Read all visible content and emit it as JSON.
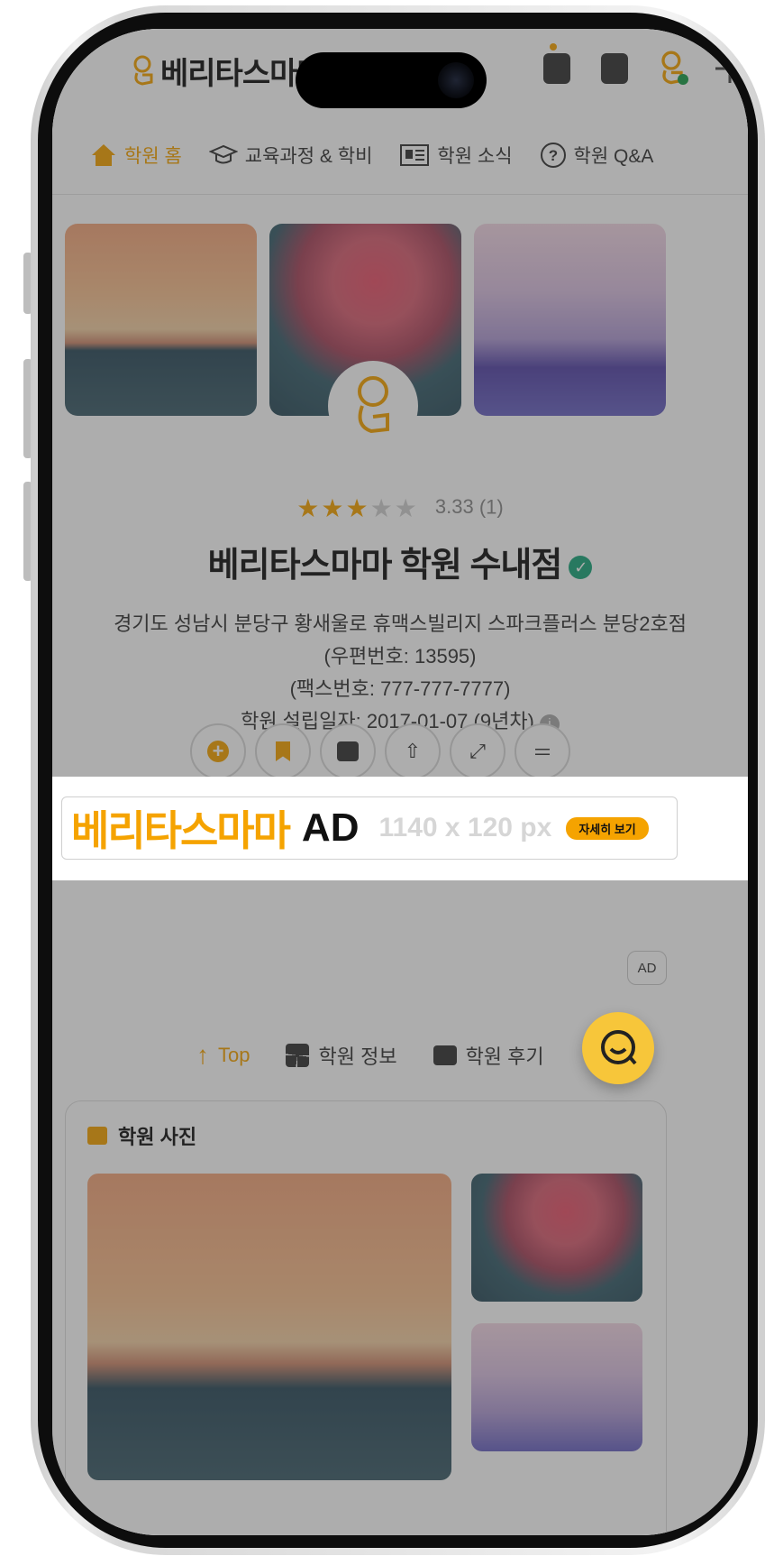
{
  "brand": {
    "name": "베리타스마마"
  },
  "tabs": [
    {
      "label": "학원 홈",
      "icon": "home-icon",
      "active": true
    },
    {
      "label": "교육과정 & 학비",
      "icon": "graduation-cap-icon"
    },
    {
      "label": "학원 소식",
      "icon": "newspaper-icon"
    },
    {
      "label": "학원 Q&A",
      "icon": "question-circle-icon"
    }
  ],
  "academy": {
    "rating_value": "3.33",
    "rating_count": "(1)",
    "rating": 3.33,
    "name": "베리타스마마 학원 수내점",
    "address": "경기도 성남시 분당구 황새울로 휴맥스빌리지 스파크플러스 분당2호점",
    "postal": "(우편번호: 13595)",
    "fax": "(팩스번호: 777-777-7777)",
    "founded": "학원 설립일자: 2017-01-07 (9년차)"
  },
  "ad": {
    "brand": "베리타스마마",
    "label": "AD",
    "size": "1140 x 120 px",
    "button": "자세히 보기",
    "badge": "AD"
  },
  "quicknav": {
    "top": "Top",
    "info": "학원 정보",
    "reviews": "학원 후기"
  },
  "photos": {
    "title": "학원 사진"
  },
  "colors": {
    "accent": "#f5a300",
    "verified": "#1aa57a",
    "fab": "#f7c63a"
  }
}
